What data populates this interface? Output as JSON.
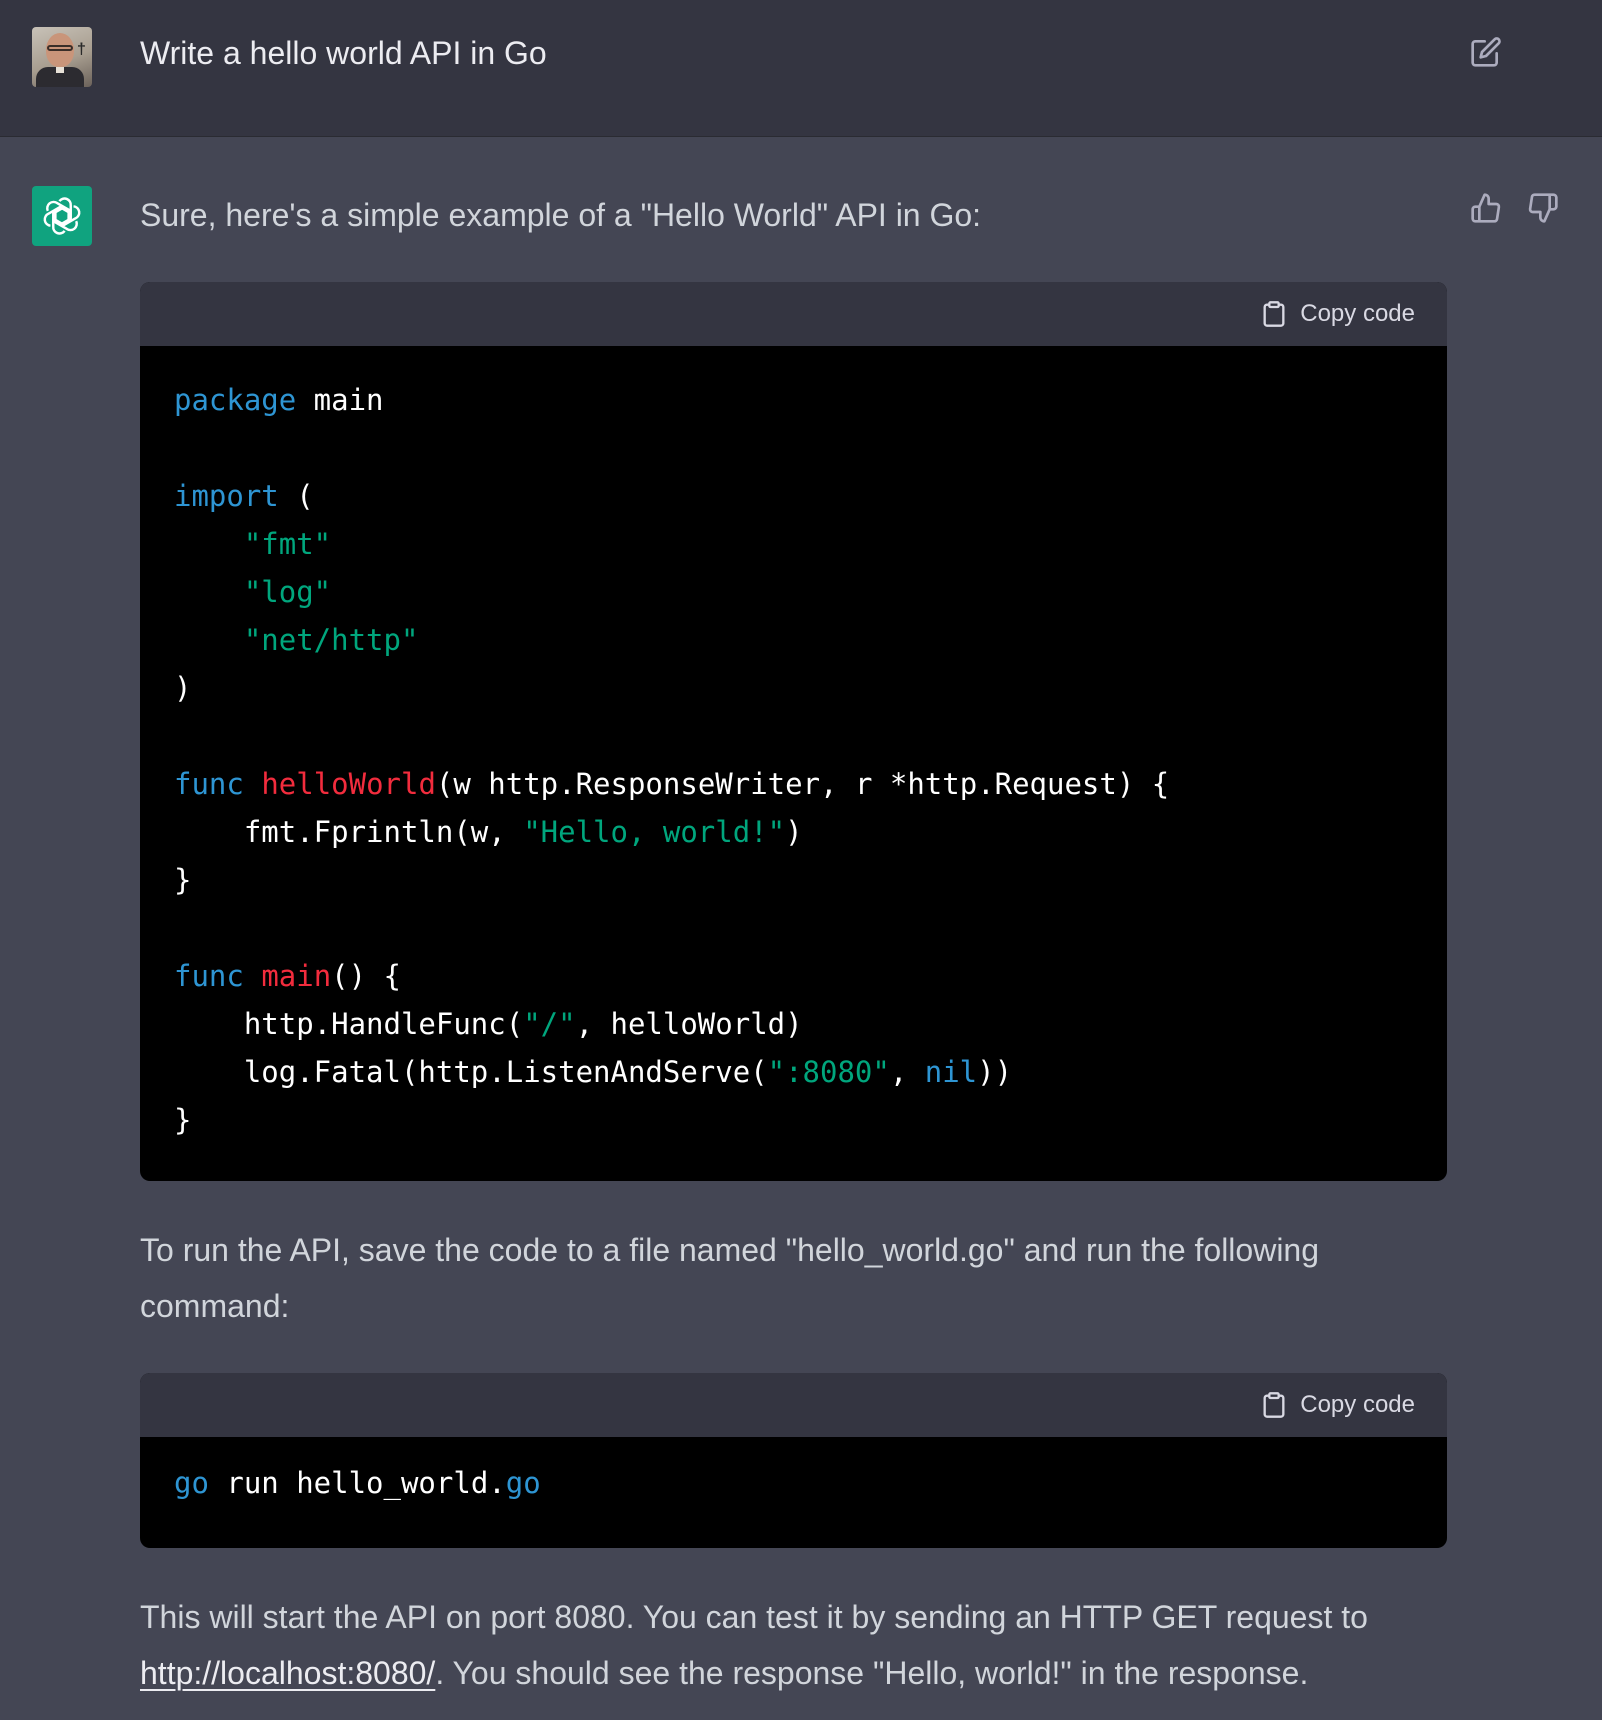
{
  "user_message": {
    "text": "Write a hello world API in Go"
  },
  "assistant": {
    "intro": "Sure, here's a simple example of a \"Hello World\" API in Go:",
    "copy_label": "Copy code",
    "code_main": [
      [
        {
          "t": "kw",
          "s": "package"
        },
        {
          "t": "plain",
          "s": " main"
        }
      ],
      [],
      [
        {
          "t": "kw",
          "s": "import"
        },
        {
          "t": "plain",
          "s": " ("
        }
      ],
      [
        {
          "t": "plain",
          "s": "    "
        },
        {
          "t": "str",
          "s": "\"fmt\""
        }
      ],
      [
        {
          "t": "plain",
          "s": "    "
        },
        {
          "t": "str",
          "s": "\"log\""
        }
      ],
      [
        {
          "t": "plain",
          "s": "    "
        },
        {
          "t": "str",
          "s": "\"net/http\""
        }
      ],
      [
        {
          "t": "plain",
          "s": ")"
        }
      ],
      [],
      [
        {
          "t": "kw",
          "s": "func"
        },
        {
          "t": "plain",
          "s": " "
        },
        {
          "t": "fn",
          "s": "helloWorld"
        },
        {
          "t": "plain",
          "s": "(w http.ResponseWriter, r *http.Request) {"
        }
      ],
      [
        {
          "t": "plain",
          "s": "    fmt.Fprintln(w, "
        },
        {
          "t": "str",
          "s": "\"Hello, world!\""
        },
        {
          "t": "plain",
          "s": ")"
        }
      ],
      [
        {
          "t": "plain",
          "s": "}"
        }
      ],
      [],
      [
        {
          "t": "kw",
          "s": "func"
        },
        {
          "t": "plain",
          "s": " "
        },
        {
          "t": "fn",
          "s": "main"
        },
        {
          "t": "plain",
          "s": "() {"
        }
      ],
      [
        {
          "t": "plain",
          "s": "    http.HandleFunc("
        },
        {
          "t": "str",
          "s": "\"/\""
        },
        {
          "t": "plain",
          "s": ", helloWorld)"
        }
      ],
      [
        {
          "t": "plain",
          "s": "    log.Fatal(http.ListenAndServe("
        },
        {
          "t": "str",
          "s": "\":8080\""
        },
        {
          "t": "plain",
          "s": ", "
        },
        {
          "t": "kw",
          "s": "nil"
        },
        {
          "t": "plain",
          "s": "))"
        }
      ],
      [
        {
          "t": "plain",
          "s": "}"
        }
      ]
    ],
    "run_instructions_1": "To run the API, save the code to a file named \"hello_world.go\" and run the following",
    "run_instructions_2": "command:",
    "code_cmd": [
      [
        {
          "t": "kw",
          "s": "go"
        },
        {
          "t": "plain",
          "s": " run hello_world."
        },
        {
          "t": "kw",
          "s": "go"
        }
      ]
    ],
    "outro_1": "This will start the API on port 8080. You can test it by sending an HTTP GET request to",
    "outro_link": "http://localhost:8080/",
    "outro_2": ". You should see the response \"Hello, world!\" in the response."
  },
  "icons": {
    "user_avatar": "user-photo-avatar",
    "bot_avatar": "openai-logo-icon",
    "edit": "edit-icon",
    "copy": "clipboard-icon",
    "thumb_up": "thumbs-up-icon",
    "thumb_down": "thumbs-down-icon"
  },
  "colors": {
    "keyword": "#2e95d3",
    "function": "#f22c3d",
    "string": "#00a67d",
    "brand": "#10a37f"
  }
}
